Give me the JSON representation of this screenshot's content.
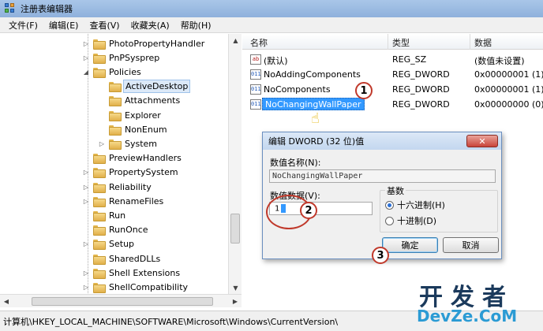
{
  "window": {
    "title": "注册表编辑器"
  },
  "menu": [
    "文件(F)",
    "编辑(E)",
    "查看(V)",
    "收藏夹(A)",
    "帮助(H)"
  ],
  "tree": {
    "items": [
      {
        "label": "PhotoPropertyHandler",
        "expander": "▷",
        "indent": 0
      },
      {
        "label": "PnPSysprep",
        "expander": "▷",
        "indent": 0
      },
      {
        "label": "Policies",
        "expander": "◢",
        "indent": 0
      },
      {
        "label": "ActiveDesktop",
        "expander": "",
        "indent": 1,
        "selected": true
      },
      {
        "label": "Attachments",
        "expander": "",
        "indent": 1
      },
      {
        "label": "Explorer",
        "expander": "",
        "indent": 1
      },
      {
        "label": "NonEnum",
        "expander": "",
        "indent": 1
      },
      {
        "label": "System",
        "expander": "▷",
        "indent": 1
      },
      {
        "label": "PreviewHandlers",
        "expander": "",
        "indent": 0
      },
      {
        "label": "PropertySystem",
        "expander": "▷",
        "indent": 0
      },
      {
        "label": "Reliability",
        "expander": "▷",
        "indent": 0
      },
      {
        "label": "RenameFiles",
        "expander": "▷",
        "indent": 0
      },
      {
        "label": "Run",
        "expander": "",
        "indent": 0
      },
      {
        "label": "RunOnce",
        "expander": "",
        "indent": 0
      },
      {
        "label": "Setup",
        "expander": "▷",
        "indent": 0
      },
      {
        "label": "SharedDLLs",
        "expander": "",
        "indent": 0
      },
      {
        "label": "Shell Extensions",
        "expander": "▷",
        "indent": 0
      },
      {
        "label": "ShellCompatibility",
        "expander": "▷",
        "indent": 0
      }
    ]
  },
  "list": {
    "columns": {
      "name": "名称",
      "type": "类型",
      "data": "数据"
    },
    "rows": [
      {
        "icon": "ab",
        "kind": "sz",
        "name": "(默认)",
        "type": "REG_SZ",
        "data": "(数值未设置)"
      },
      {
        "icon": "011",
        "kind": "dword",
        "name": "NoAddingComponents",
        "type": "REG_DWORD",
        "data": "0x00000001 (1)"
      },
      {
        "icon": "011",
        "kind": "dword",
        "name": "NoComponents",
        "type": "REG_DWORD",
        "data": "0x00000001 (1)"
      },
      {
        "icon": "011",
        "kind": "dword",
        "name": "NoChangingWallPaper",
        "type": "REG_DWORD",
        "data": "0x00000000 (0)",
        "selected": true
      }
    ]
  },
  "dialog": {
    "title": "编辑 DWORD (32 位)值",
    "close": "✕",
    "value_name_label": "数值名称(N):",
    "value_name": "NoChangingWallPaper",
    "value_data_label": "数值数据(V):",
    "value_data": "1",
    "radix_label": "基数",
    "hex_label": "十六进制(H)",
    "dec_label": "十进制(D)",
    "ok": "确定",
    "cancel": "取消"
  },
  "callouts": [
    "1",
    "2",
    "3"
  ],
  "status": "计算机\\HKEY_LOCAL_MACHINE\\SOFTWARE\\Microsoft\\Windows\\CurrentVersion\\",
  "watermark": {
    "main": "开发者",
    "sub": "DevZe.CoM"
  }
}
